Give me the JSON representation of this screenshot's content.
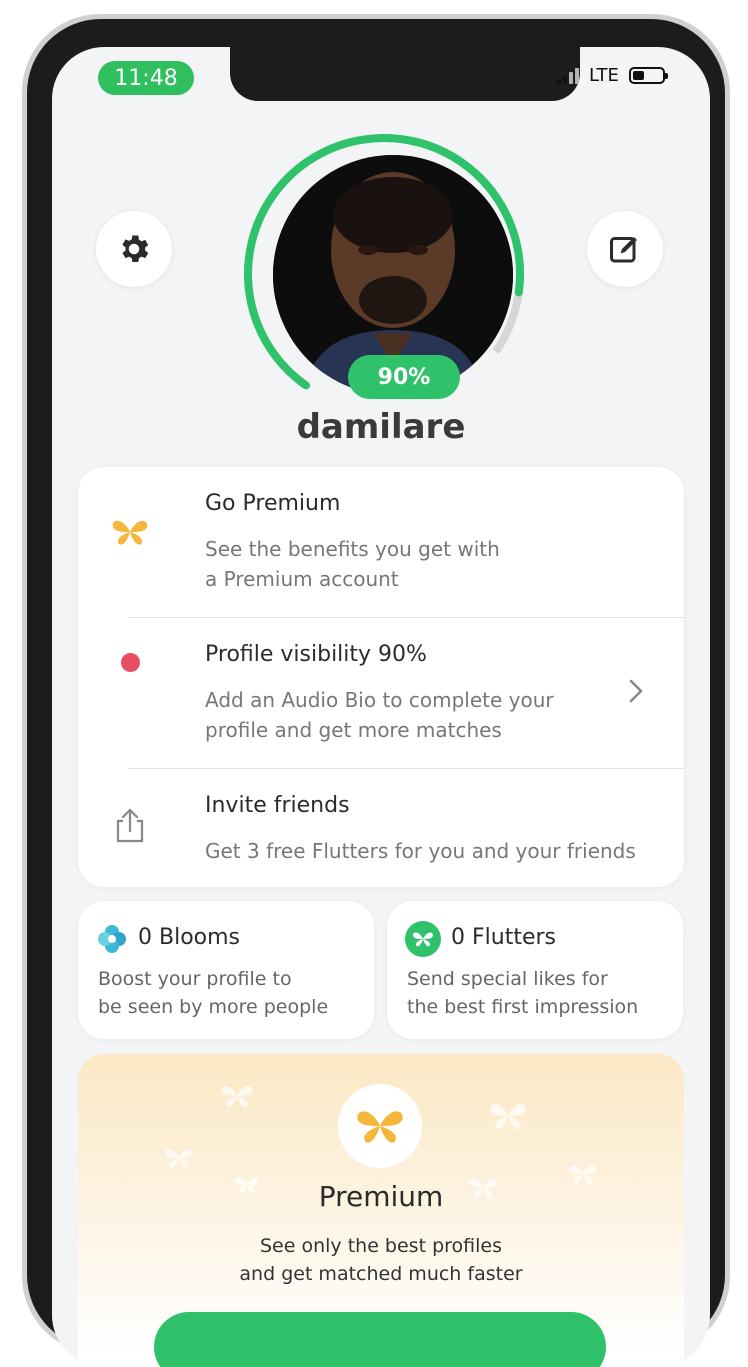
{
  "status_bar": {
    "time": "11:48",
    "network": "LTE"
  },
  "profile": {
    "completion": "90%",
    "name": "damilare"
  },
  "menu": [
    {
      "title": "Go Premium",
      "desc_line1": "See the benefits you get with",
      "desc_line2": "a Premium account"
    },
    {
      "title": "Profile visibility 90%",
      "desc_line1": "Add an Audio Bio to complete your",
      "desc_line2": "profile and get more matches"
    },
    {
      "title": "Invite friends",
      "desc_line1": "Get 3 free Flutters for you and your friends"
    }
  ],
  "blooms": {
    "title": "0 Blooms",
    "desc_line1": "Boost your profile to",
    "desc_line2": "be seen by more people"
  },
  "flutters": {
    "title": "0 Flutters",
    "desc_line1": "Send special likes for",
    "desc_line2": "the best first impression"
  },
  "premium_promo": {
    "title": "Premium",
    "desc_line1": "See only the best profiles",
    "desc_line2": "and get matched much faster"
  },
  "colors": {
    "accent": "#2fc26a",
    "premium": "#f5b63a",
    "alert": "#e94d62"
  },
  "icons": [
    "gear-icon",
    "edit-icon",
    "butterfly-icon",
    "red-dot-icon",
    "chevron-right-icon",
    "share-icon",
    "bloom-icon",
    "flutter-icon"
  ]
}
